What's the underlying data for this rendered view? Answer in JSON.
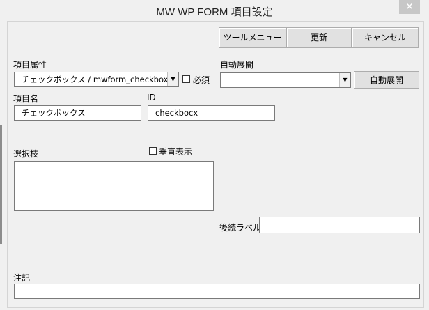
{
  "window": {
    "title": "MW WP FORM 項目設定",
    "close_glyph": "✕"
  },
  "toolbar": {
    "tool_menu_label": "ツールメニュー",
    "update_label": "更新",
    "cancel_label": "キャンセル"
  },
  "fields": {
    "item_attribute_label": "項目属性",
    "item_attribute_value": "チェックボックス / mwform_checkbox",
    "required_label": "必須",
    "auto_expand_label": "自動展開",
    "auto_expand_value": "",
    "auto_expand_button": "自動展開",
    "item_name_label": "項目名",
    "item_name_value": "チェックボックス",
    "id_label": "ID",
    "id_value": "checkbocx",
    "choices_label": "選択枝",
    "vertical_display_label": "垂直表示",
    "choices_value": "",
    "suffix_label": "後続ラベル",
    "suffix_value": "",
    "note_label": "注記",
    "note_value": ""
  },
  "icons": {
    "dropdown_arrow": "▼"
  }
}
